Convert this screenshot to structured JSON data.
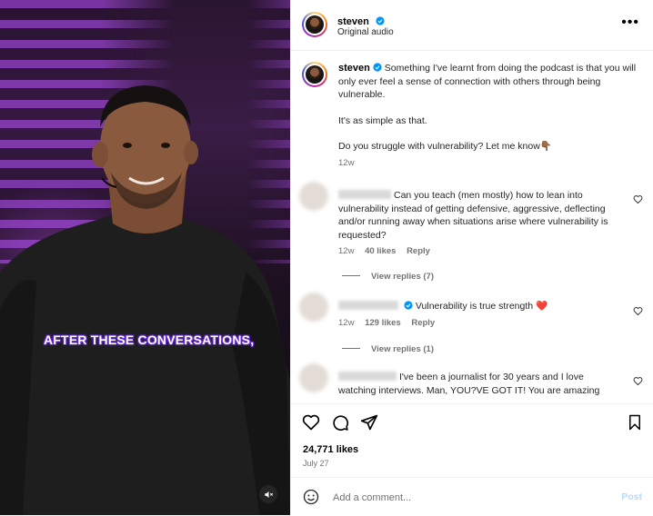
{
  "video": {
    "caption": "AFTER THESE CONVERSATIONS,",
    "mute_icon": "speaker-muted-icon"
  },
  "header": {
    "username": "steven",
    "subtitle": "Original audio",
    "more_icon": "more-options-icon"
  },
  "post": {
    "username": "steven",
    "lines": [
      "Something I've learnt from doing the podcast is that you will only ever feel a sense of connection with others through being vulnerable.",
      "It's as simple as that.",
      "Do you struggle with vulnerability? Let me know👇🏾"
    ],
    "time": "12w"
  },
  "comments": [
    {
      "text": "Can you teach (men mostly) how to lean into vulnerability instead of getting defensive, aggressive, deflecting and/or running away when situations arise where vulnerability is requested?",
      "time": "12w",
      "likes": "40 likes",
      "reply": "Reply",
      "view_replies": "View replies (7)"
    },
    {
      "text": "Vulnerability is true strength ❤️",
      "time": "12w",
      "likes": "129 likes",
      "reply": "Reply",
      "view_replies": "View replies (1)"
    },
    {
      "text": "I've been a journalist for 30 years and I love watching interviews. Man, YOU?VE GOT IT! You are amazing"
    }
  ],
  "actions": {
    "likes": "24,771 likes",
    "date": "July 27"
  },
  "add_comment": {
    "placeholder": "Add a comment...",
    "post_label": "Post"
  },
  "colors": {
    "verified": "#0095f6",
    "heart_red": "#ed4956"
  }
}
